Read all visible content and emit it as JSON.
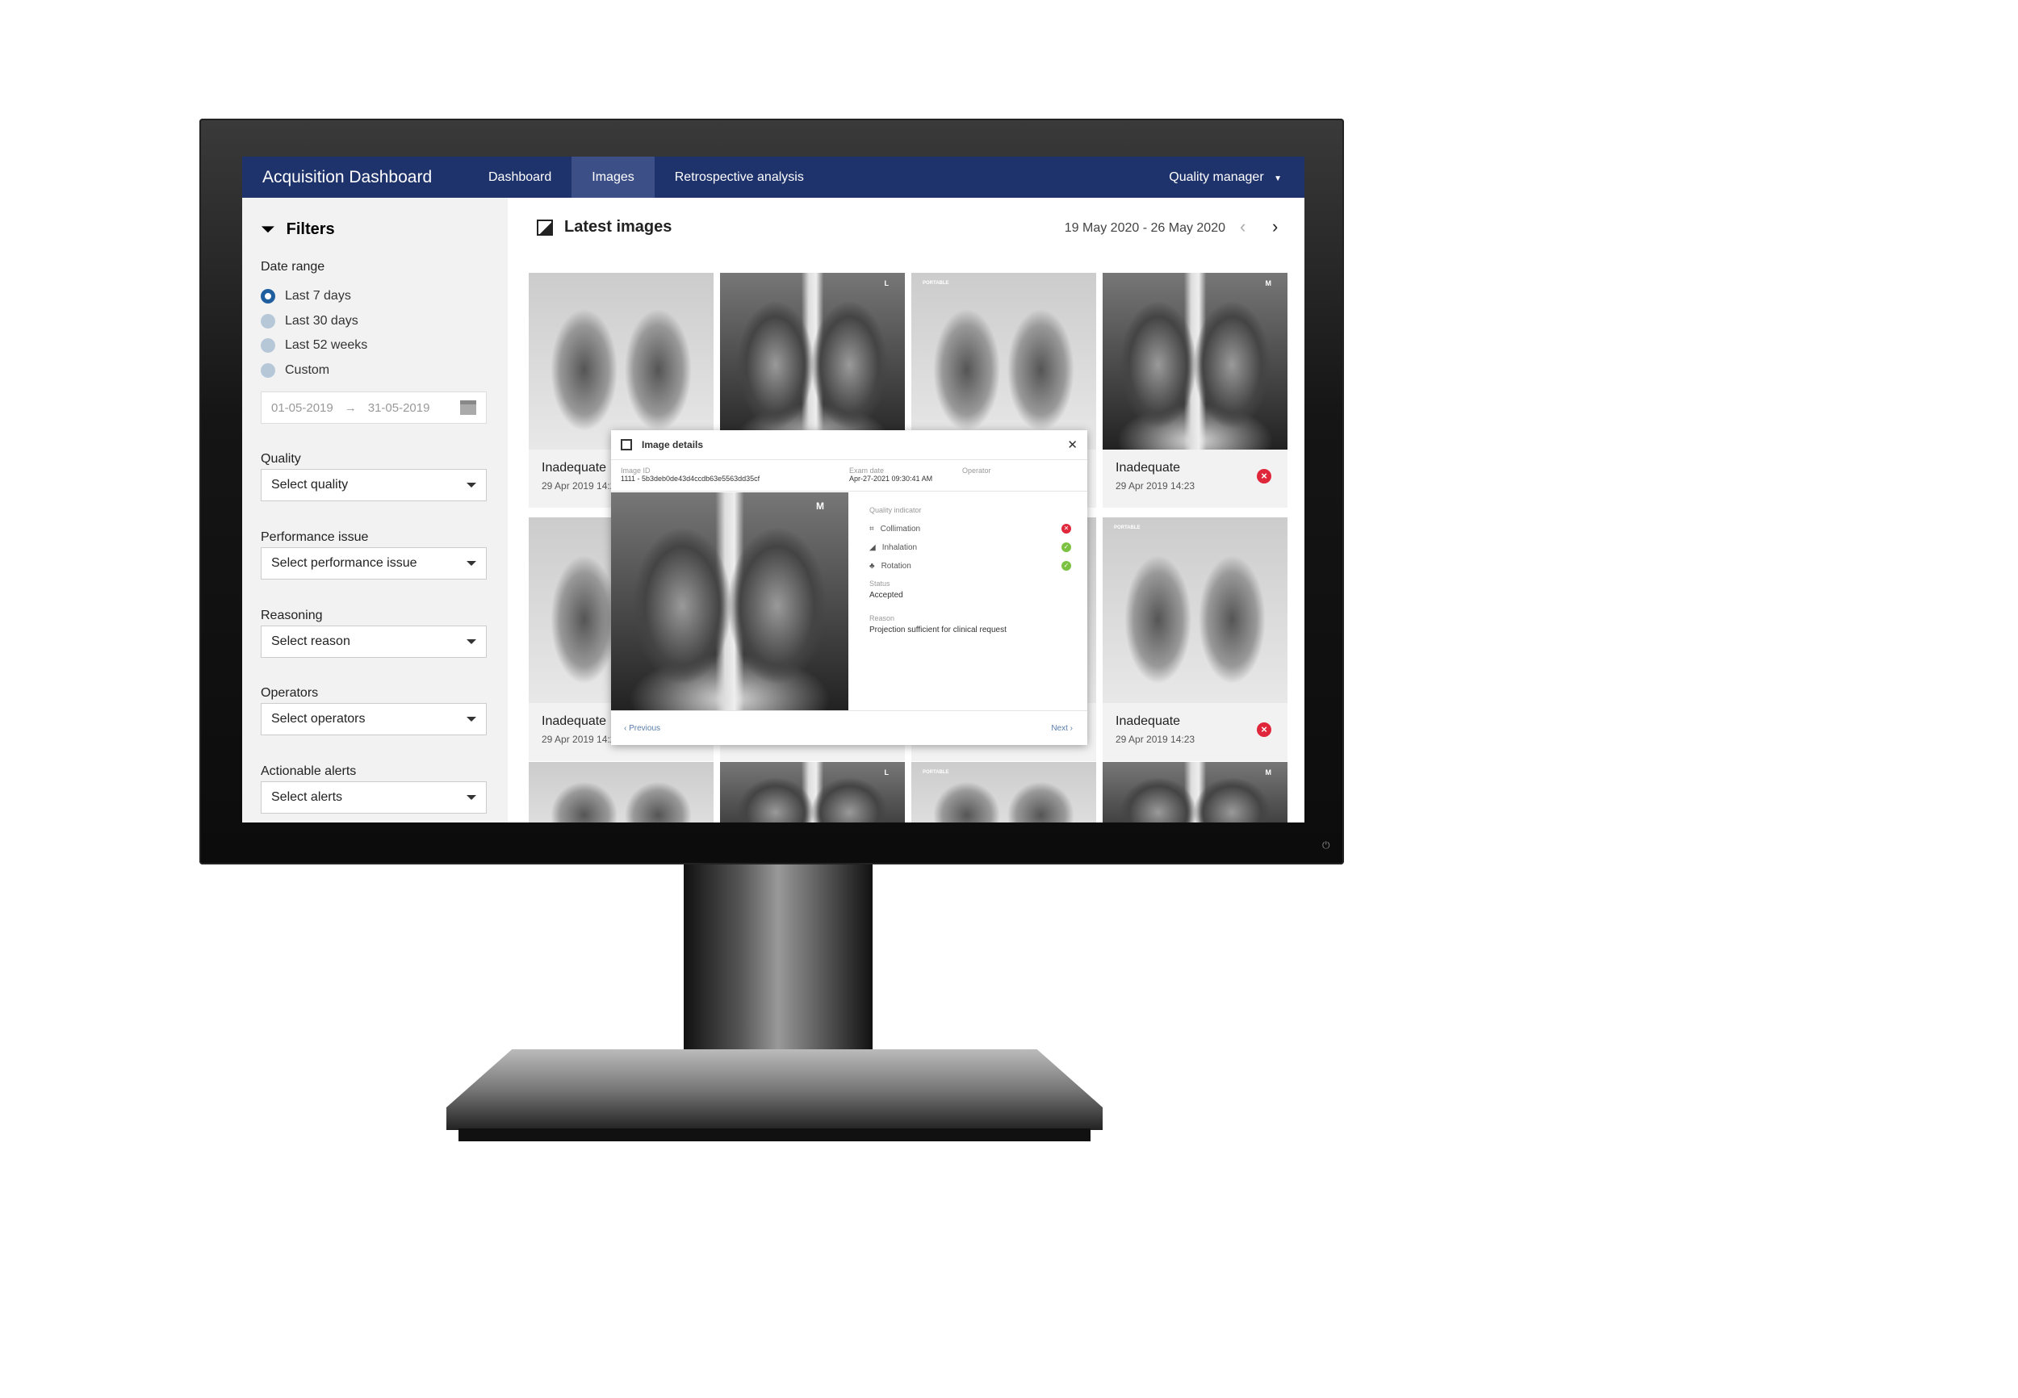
{
  "nav": {
    "brand": "Acquisition Dashboard",
    "tabs": [
      {
        "label": "Dashboard"
      },
      {
        "label": "Images",
        "active": true
      },
      {
        "label": "Retrospective analysis"
      }
    ],
    "user": "Quality manager"
  },
  "sidebar": {
    "title": "Filters",
    "date_range": {
      "label": "Date range",
      "options": [
        "Last 7 days",
        "Last 30 days",
        "Last 52 weeks",
        "Custom"
      ],
      "selected": "Last 7 days",
      "from": "01-05-2019",
      "to": "31-05-2019"
    },
    "filters": [
      {
        "label": "Quality",
        "placeholder": "Select quality"
      },
      {
        "label": "Performance issue",
        "placeholder": "Select performance issue"
      },
      {
        "label": "Reasoning",
        "placeholder": "Select reason"
      },
      {
        "label": "Operators",
        "placeholder": "Select operators"
      },
      {
        "label": "Actionable alerts",
        "placeholder": "Select alerts"
      }
    ]
  },
  "content": {
    "title": "Latest images",
    "date_range": "19 May 2020 - 26 May 2020",
    "images": [
      {
        "status": "Inadequate",
        "date": "29 Apr 2019 14:23"
      },
      {
        "status": "",
        "date": "",
        "marker": "L"
      },
      {
        "status": "",
        "date": "",
        "marker": "PORTABLE"
      },
      {
        "status": "Inadequate",
        "date": "29 Apr 2019 14:23",
        "marker": "M"
      },
      {
        "status": "Inadequate",
        "date": "29 Apr 2019 14:23"
      },
      {
        "status": "",
        "date": ""
      },
      {
        "status": "",
        "date": ""
      },
      {
        "status": "Inadequate",
        "date": "29 Apr 2019 14:23",
        "marker": "PORTABLE"
      },
      {
        "status": "",
        "date": ""
      },
      {
        "status": "",
        "date": "",
        "marker": "L"
      },
      {
        "status": "",
        "date": "",
        "marker": "PORTABLE"
      },
      {
        "status": "",
        "date": "",
        "marker": "M"
      }
    ]
  },
  "modal": {
    "title": "Image details",
    "image_id_label": "Image ID",
    "image_id": "1111 - 5b3deb0de43d4ccdb63e5563dd35cf",
    "exam_date_label": "Exam date",
    "exam_date": "Apr-27-2021 09:30:41 AM",
    "operator_label": "Operator",
    "operator": "",
    "quality_label": "Quality indicator",
    "indicators": [
      {
        "name": "Collimation",
        "result": "fail"
      },
      {
        "name": "Inhalation",
        "result": "pass"
      },
      {
        "name": "Rotation",
        "result": "pass"
      }
    ],
    "status_label": "Status",
    "status": "Accepted",
    "reason_label": "Reason",
    "reason": "Projection sufficient for clinical request",
    "previous": "Previous",
    "next": "Next",
    "image_marker": "M"
  },
  "colors": {
    "nav": "#1e326b",
    "nav_active": "#3c5087",
    "fail": "#e0263a",
    "pass": "#7cc242",
    "radio": "#1f5fa0"
  }
}
